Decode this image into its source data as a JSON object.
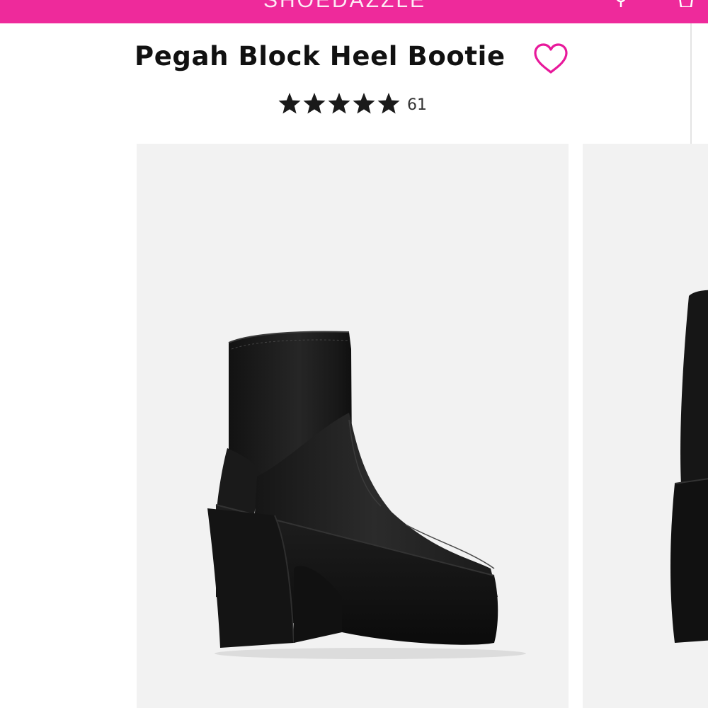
{
  "header": {
    "brand_text": "SHOEDAZZLE",
    "bar_color": "#ee2a9b"
  },
  "product": {
    "title": "Pegah Block Heel Bootie",
    "rating": 5,
    "max_rating": 5,
    "review_count": "61",
    "wishlist_icon": "heart-outline-icon",
    "accent_color": "#e8199b"
  },
  "gallery": {
    "images": [
      {
        "alt": "Black platform block heel ankle bootie, side view",
        "icon": "boot-image"
      },
      {
        "alt": "Black platform block heel ankle bootie, alternate view",
        "icon": "boot-image"
      }
    ]
  }
}
